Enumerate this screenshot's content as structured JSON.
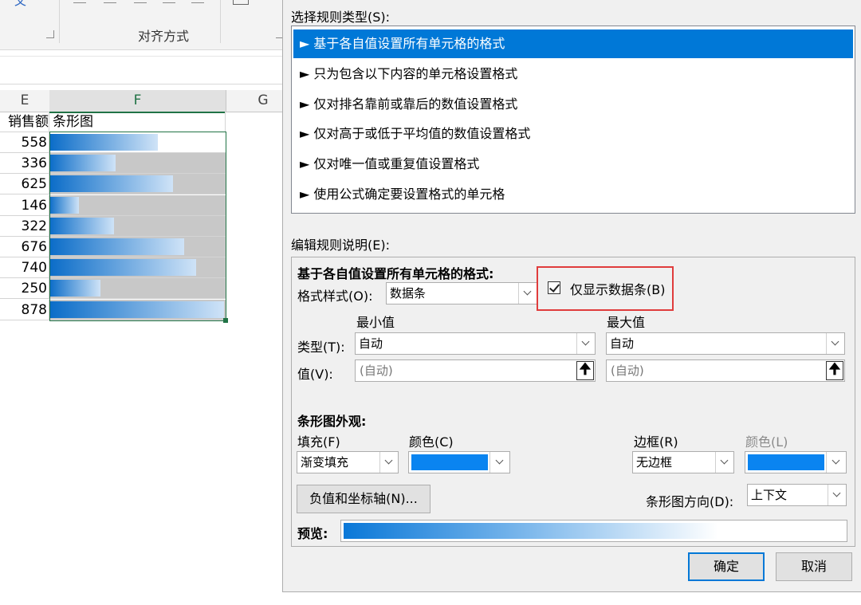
{
  "ribbon": {
    "group_label": "对齐方式",
    "partial_glyph": "文"
  },
  "sheet": {
    "columns": {
      "e": "E",
      "f": "F",
      "g": "G"
    },
    "header_e": "销售额",
    "header_f": "条形图",
    "rows": [
      {
        "value": "558",
        "bar": 0.62
      },
      {
        "value": "336",
        "bar": 0.38
      },
      {
        "value": "625",
        "bar": 0.71
      },
      {
        "value": "146",
        "bar": 0.17
      },
      {
        "value": "322",
        "bar": 0.37
      },
      {
        "value": "676",
        "bar": 0.77
      },
      {
        "value": "740",
        "bar": 0.84
      },
      {
        "value": "250",
        "bar": 0.29
      },
      {
        "value": "878",
        "bar": 1.0
      }
    ],
    "first_row_bg": "#ffffff",
    "bar_colors": {
      "dark": "#0a6cc8",
      "light": "#cfe3f7",
      "cell_bg": "#c8c8c8"
    }
  },
  "dialog": {
    "select_type_label": "选择规则类型(S):",
    "rules": [
      "► 基于各自值设置所有单元格的格式",
      "► 只为包含以下内容的单元格设置格式",
      "► 仅对排名靠前或靠后的数值设置格式",
      "► 仅对高于或低于平均值的数值设置格式",
      "► 仅对唯一值或重复值设置格式",
      "► 使用公式确定要设置格式的单元格"
    ],
    "edit_label": "编辑规则说明(E):",
    "section_title": "基于各自值设置所有单元格的格式:",
    "format_style_label": "格式样式(O):",
    "format_style_value": "数据条",
    "show_bar_only_label": "仅显示数据条(B)",
    "show_bar_only_checked": true,
    "min_label": "最小值",
    "max_label": "最大值",
    "type_label": "类型(T):",
    "min_type": "自动",
    "max_type": "自动",
    "value_label": "值(V):",
    "min_value_placeholder": "(自动)",
    "max_value_placeholder": "(自动)",
    "upload_glyph": "🠉",
    "appearance_title": "条形图外观:",
    "fill_label": "填充(F)",
    "fill_value": "渐变填充",
    "fill_color_label": "颜色(C)",
    "fill_color": "#0a84f0",
    "border_label": "边框(R)",
    "border_value": "无边框",
    "border_color_label": "颜色(L)",
    "border_color": "#0a84f0",
    "negative_axis_button": "负值和坐标轴(N)...",
    "direction_label": "条形图方向(D):",
    "direction_value": "上下文",
    "preview_label": "预览:",
    "ok_button": "确定",
    "cancel_button": "取消",
    "accent_color": "#0078d7",
    "highlight_color": "#e03c3c"
  }
}
